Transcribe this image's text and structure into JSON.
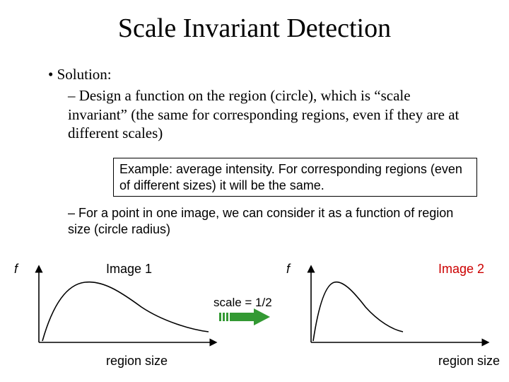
{
  "title": "Scale Invariant Detection",
  "bullet1": "Solution:",
  "dash1": "Design a function on the region (circle), which is “scale invariant” (the same for corresponding regions, even if they are at different scales)",
  "example": "Example: average intensity. For corresponding regions (even of different sizes) it will be the same.",
  "dash2": "For a point in one image, we can consider it as a function of region size (circle radius)",
  "chart1": {
    "y": "f",
    "title": "Image 1",
    "x": "region size"
  },
  "chart2": {
    "y": "f",
    "title": "Image 2",
    "x": "region size"
  },
  "scale_label": "scale = 1/2",
  "chart_data": [
    {
      "type": "line",
      "title": "Image 1",
      "xlabel": "region size",
      "ylabel": "f",
      "x": [
        0,
        10,
        20,
        30,
        40,
        50,
        55,
        60,
        70,
        80,
        100,
        130,
        170,
        210
      ],
      "y": [
        0,
        35,
        55,
        68,
        73,
        75,
        75,
        74,
        70,
        65,
        55,
        44,
        36,
        32
      ],
      "xlim": [
        0,
        230
      ],
      "ylim": [
        0,
        100
      ]
    },
    {
      "type": "line",
      "title": "Image 2",
      "xlabel": "region size",
      "ylabel": "f",
      "x": [
        0,
        5,
        10,
        15,
        20,
        25,
        28,
        30,
        35,
        40,
        50,
        65,
        85,
        105
      ],
      "y": [
        0,
        35,
        55,
        68,
        73,
        75,
        75,
        74,
        70,
        65,
        55,
        44,
        36,
        32
      ],
      "xlim": [
        0,
        230
      ],
      "ylim": [
        0,
        100
      ]
    }
  ]
}
